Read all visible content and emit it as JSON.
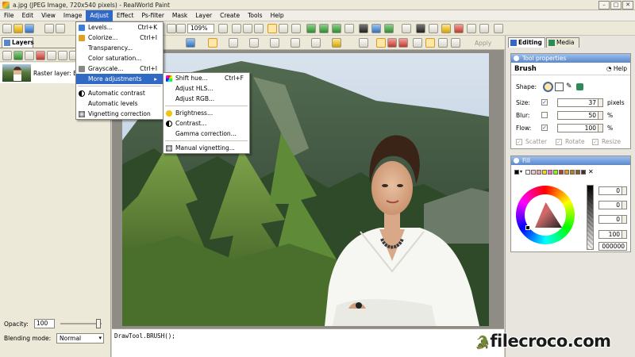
{
  "window": {
    "title": "a.jpg (JPEG Image, 720x540 pixels) - RealWorld Paint"
  },
  "menu": [
    "File",
    "Edit",
    "View",
    "Image",
    "Adjust",
    "Effect",
    "Ps-filter",
    "Mask",
    "Layer",
    "Create",
    "Tools",
    "Help"
  ],
  "toolbar": {
    "zoom": "109%",
    "apply": "Apply"
  },
  "adjust_menu": [
    {
      "label": "Levels...",
      "shortcut": "Ctrl+K",
      "icon": "levels-icon",
      "color": "#3b7dd8"
    },
    {
      "label": "Colorize...",
      "shortcut": "Ctrl+I",
      "icon": "colorize-icon",
      "color": "#e0a020"
    },
    {
      "label": "Transparency...",
      "shortcut": "",
      "icon": "",
      "color": ""
    },
    {
      "label": "Color saturation...",
      "shortcut": "",
      "icon": "",
      "color": ""
    },
    {
      "label": "Grayscale...",
      "shortcut": "Ctrl+I",
      "icon": "grayscale-icon",
      "color": "#888888"
    },
    {
      "label": "More adjustments",
      "shortcut": "",
      "icon": "",
      "color": ""
    },
    {
      "label": "Automatic contrast",
      "shortcut": "",
      "icon": "contrast-icon",
      "color": "#222222"
    },
    {
      "label": "Automatic levels",
      "shortcut": "",
      "icon": "",
      "color": ""
    },
    {
      "label": "Vignetting correction",
      "shortcut": "",
      "icon": "vignetting-icon",
      "color": "#555555"
    }
  ],
  "submenu": [
    {
      "label": "Shift hue...",
      "shortcut": "Ctrl+F",
      "icon": "hue-icon",
      "color": "#c0392b"
    },
    {
      "label": "Adjust HLS...",
      "shortcut": "",
      "icon": "",
      "color": ""
    },
    {
      "label": "Adjust RGB...",
      "shortcut": "",
      "icon": "",
      "color": ""
    },
    {
      "label": "Brightness...",
      "shortcut": "",
      "icon": "brightness-icon",
      "color": "#f1c40f"
    },
    {
      "label": "Contrast...",
      "shortcut": "",
      "icon": "contrast-icon",
      "color": "#222222"
    },
    {
      "label": "Gamma correction...",
      "shortcut": "",
      "icon": "",
      "color": ""
    },
    {
      "label": "Manual vignetting...",
      "shortcut": "",
      "icon": "vignetting-icon",
      "color": "#555555"
    }
  ],
  "layers": {
    "tab": "Layers",
    "layer_name": "Raster layer: Background",
    "opacity_label": "Opacity:",
    "opacity": "100",
    "blend_label": "Blending mode:",
    "blend_mode": "Normal"
  },
  "console": {
    "text": "DrawTool.BRUSH();"
  },
  "right": {
    "tabs": [
      "Editing",
      "Media"
    ],
    "tool_properties": {
      "header": "Tool properties",
      "tool": "Brush",
      "help": "Help",
      "shape_label": "Shape:",
      "size_label": "Size:",
      "size": "37",
      "size_unit": "pixels",
      "blur_label": "Blur:",
      "blur": "50",
      "blur_unit": "%",
      "flow_label": "Flow:",
      "flow": "100",
      "flow_unit": "%",
      "scatter": "Scatter",
      "rotate": "Rotate",
      "resize": "Resize"
    },
    "fill": {
      "header": "Fill",
      "values": [
        "0",
        "0",
        "0",
        "100",
        "000000"
      ],
      "swatches": [
        "#000000",
        "#ffffff",
        "#f4c6c6",
        "#f3a0a0",
        "#ffd700",
        "#ff66cc",
        "#7fff00",
        "#c0392b",
        "#e69b1e",
        "#b8860b",
        "#8b5a2b",
        "#4b3020"
      ]
    }
  },
  "watermark": "filecroco.com"
}
